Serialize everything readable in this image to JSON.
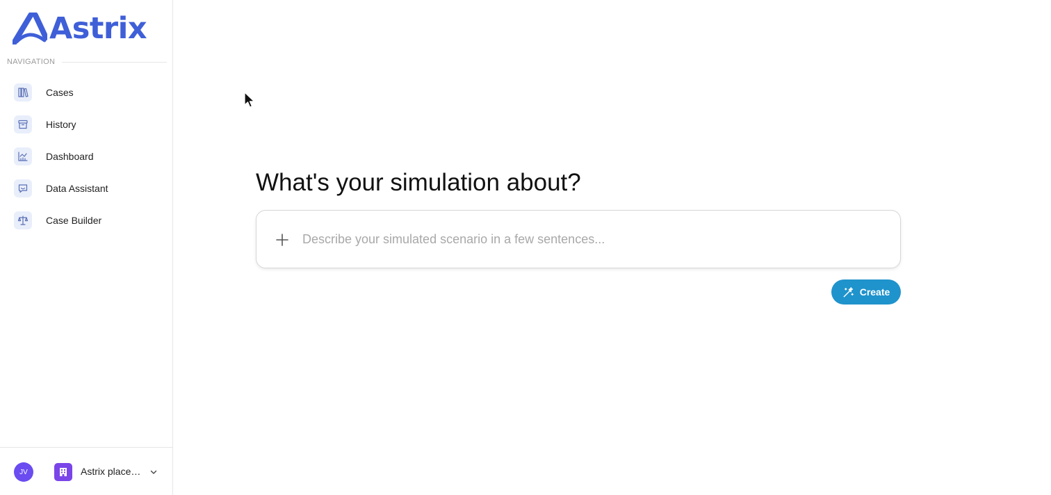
{
  "brand": {
    "name": "Astrix",
    "color": "#3f5fd8"
  },
  "sidebar": {
    "section_label": "NAVIGATION",
    "items": [
      {
        "label": "Cases",
        "icon": "books-icon"
      },
      {
        "label": "History",
        "icon": "archive-icon"
      },
      {
        "label": "Dashboard",
        "icon": "chart-icon"
      },
      {
        "label": "Data Assistant",
        "icon": "chat-icon"
      },
      {
        "label": "Case Builder",
        "icon": "scale-icon"
      }
    ],
    "footer": {
      "avatar_initials": "JV",
      "org_name": "Astrix place…",
      "org_icon": "building-icon",
      "chevron_icon": "chevron-down-icon"
    }
  },
  "main": {
    "heading": "What's your simulation about?",
    "prompt": {
      "placeholder": "Describe your simulated scenario in a few sentences...",
      "value": "",
      "add_icon": "plus-icon"
    },
    "create_button": {
      "label": "Create",
      "icon": "magic-wand-icon",
      "color": "#1f93cc"
    }
  }
}
